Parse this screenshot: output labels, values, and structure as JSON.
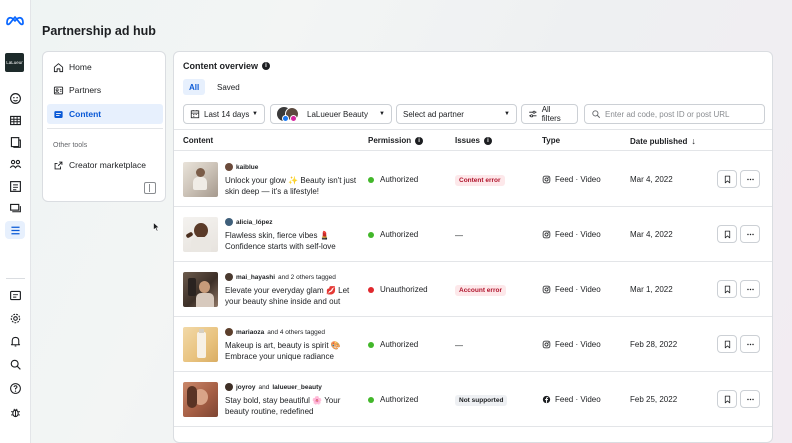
{
  "app": {
    "title": "Partnership ad hub",
    "brand_tile": "LaLueur"
  },
  "nav": {
    "items": [
      {
        "label": "Home",
        "icon": "home-icon"
      },
      {
        "label": "Partners",
        "icon": "partners-icon"
      },
      {
        "label": "Content",
        "icon": "content-icon",
        "active": true
      }
    ],
    "section_label": "Other tools",
    "tools": [
      {
        "label": "Creator marketplace",
        "icon": "external-link-icon"
      }
    ]
  },
  "overview": {
    "title": "Content overview",
    "tabs": [
      {
        "label": "All",
        "active": true
      },
      {
        "label": "Saved"
      }
    ],
    "filters": {
      "date_range": "Last 14 days",
      "account": "LaLueuer Beauty",
      "ad_partner_placeholder": "Select ad partner",
      "all_filters": "All filters",
      "search_placeholder": "Enter ad code, post ID or post URL"
    },
    "columns": {
      "content": "Content",
      "permission": "Permission",
      "issues": "Issues",
      "type": "Type",
      "date": "Date published"
    }
  },
  "rows": [
    {
      "creator": "kaiblue",
      "tagged": "",
      "caption": "Unlock your glow ✨ Beauty isn't just skin deep — it's a lifestyle!",
      "permission": "Authorized",
      "permission_color": "#42b72a",
      "issue": "Content error",
      "issue_kind": "err",
      "type": "Feed · Video",
      "type_icon": "instagram-icon",
      "date": "Mar 4, 2022"
    },
    {
      "creator": "alicia_lópez",
      "tagged": "",
      "caption": "Flawless skin, fierce vibes 💄 Confidence starts with self-love",
      "permission": "Authorized",
      "permission_color": "#42b72a",
      "issue": "—",
      "issue_kind": "none",
      "type": "Feed · Video",
      "type_icon": "instagram-icon",
      "date": "Mar 4, 2022"
    },
    {
      "creator": "mai_hayashi",
      "tagged": "and 2 others tagged",
      "caption": "Elevate your everyday glam 💋 Let your beauty shine inside and out",
      "permission": "Unauthorized",
      "permission_color": "#e0282d",
      "issue": "Account error",
      "issue_kind": "err",
      "type": "Feed · Video",
      "type_icon": "instagram-icon",
      "date": "Mar 1, 2022"
    },
    {
      "creator": "mariaoza",
      "tagged": "and 4 others tagged",
      "caption": "Makeup is art, beauty is spirit 🎨 Embrace your unique radiance",
      "permission": "Authorized",
      "permission_color": "#42b72a",
      "issue": "—",
      "issue_kind": "none",
      "type": "Feed · Video",
      "type_icon": "instagram-icon",
      "date": "Feb 28, 2022"
    },
    {
      "creator": "joyroy",
      "tagged": "and",
      "tagged2": "lalueuer_beauty",
      "caption": "Stay bold, stay beautiful 🌸 Your beauty routine, redefined",
      "permission": "Authorized",
      "permission_color": "#42b72a",
      "issue": "Not supported",
      "issue_kind": "ns",
      "type": "Feed · Video",
      "type_icon": "facebook-icon",
      "date": "Feb 25, 2022"
    }
  ],
  "colors": {
    "accent": "#0a59d6",
    "authorized": "#42b72a",
    "unauthorized": "#e0282d",
    "error_bg": "#fde8ea"
  }
}
